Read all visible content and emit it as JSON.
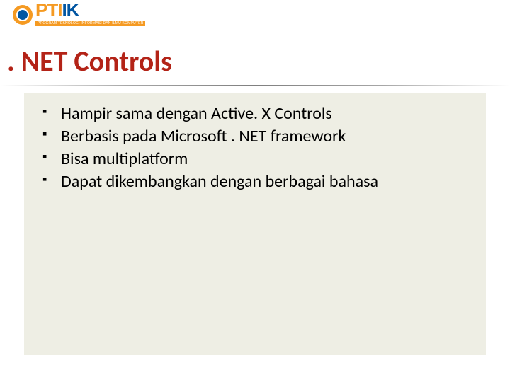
{
  "logo": {
    "text_part1": "PTI",
    "text_part2": "IK",
    "subtitle": "PROGRAM TEKNOLOGI INFORMASI DAN ILMU KOMPUTER"
  },
  "title": ". NET Controls",
  "bullets": [
    "Hampir sama dengan Active. X Controls",
    "Berbasis pada Microsoft . NET framework",
    "Bisa multiplatform",
    "Dapat dikembangkan dengan berbagai bahasa"
  ]
}
